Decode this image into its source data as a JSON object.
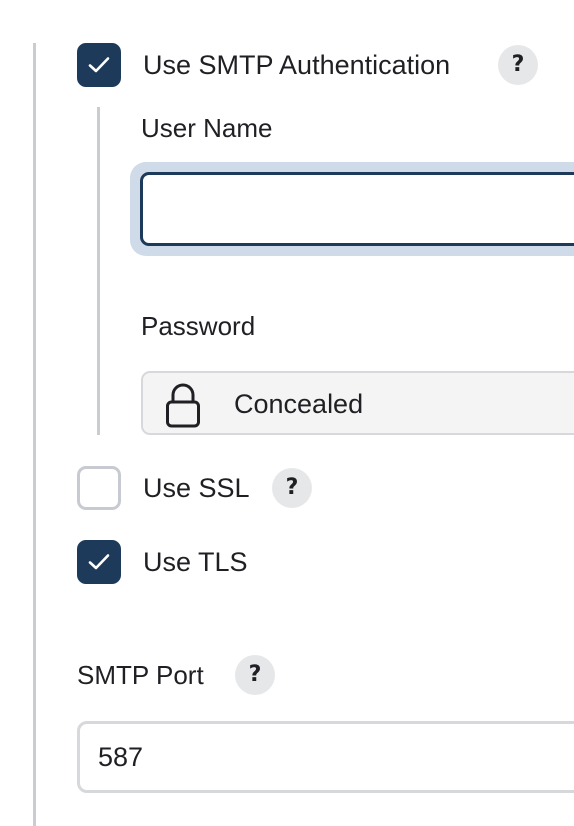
{
  "smtp_auth": {
    "label": "Use SMTP Authentication",
    "checked": true,
    "help": "?"
  },
  "user_name": {
    "label": "User Name",
    "value": ""
  },
  "password": {
    "label": "Password",
    "value_display": "Concealed",
    "icon": "lock-icon"
  },
  "use_ssl": {
    "label": "Use SSL",
    "checked": false,
    "help": "?"
  },
  "use_tls": {
    "label": "Use TLS",
    "checked": true
  },
  "smtp_port": {
    "label": "SMTP Port",
    "value": "587",
    "help": "?"
  },
  "colors": {
    "accent": "#1e3a5a",
    "focus_ring": "#cfdbe8",
    "border": "#d6d8dc",
    "help_bg": "#e6e7e9"
  }
}
